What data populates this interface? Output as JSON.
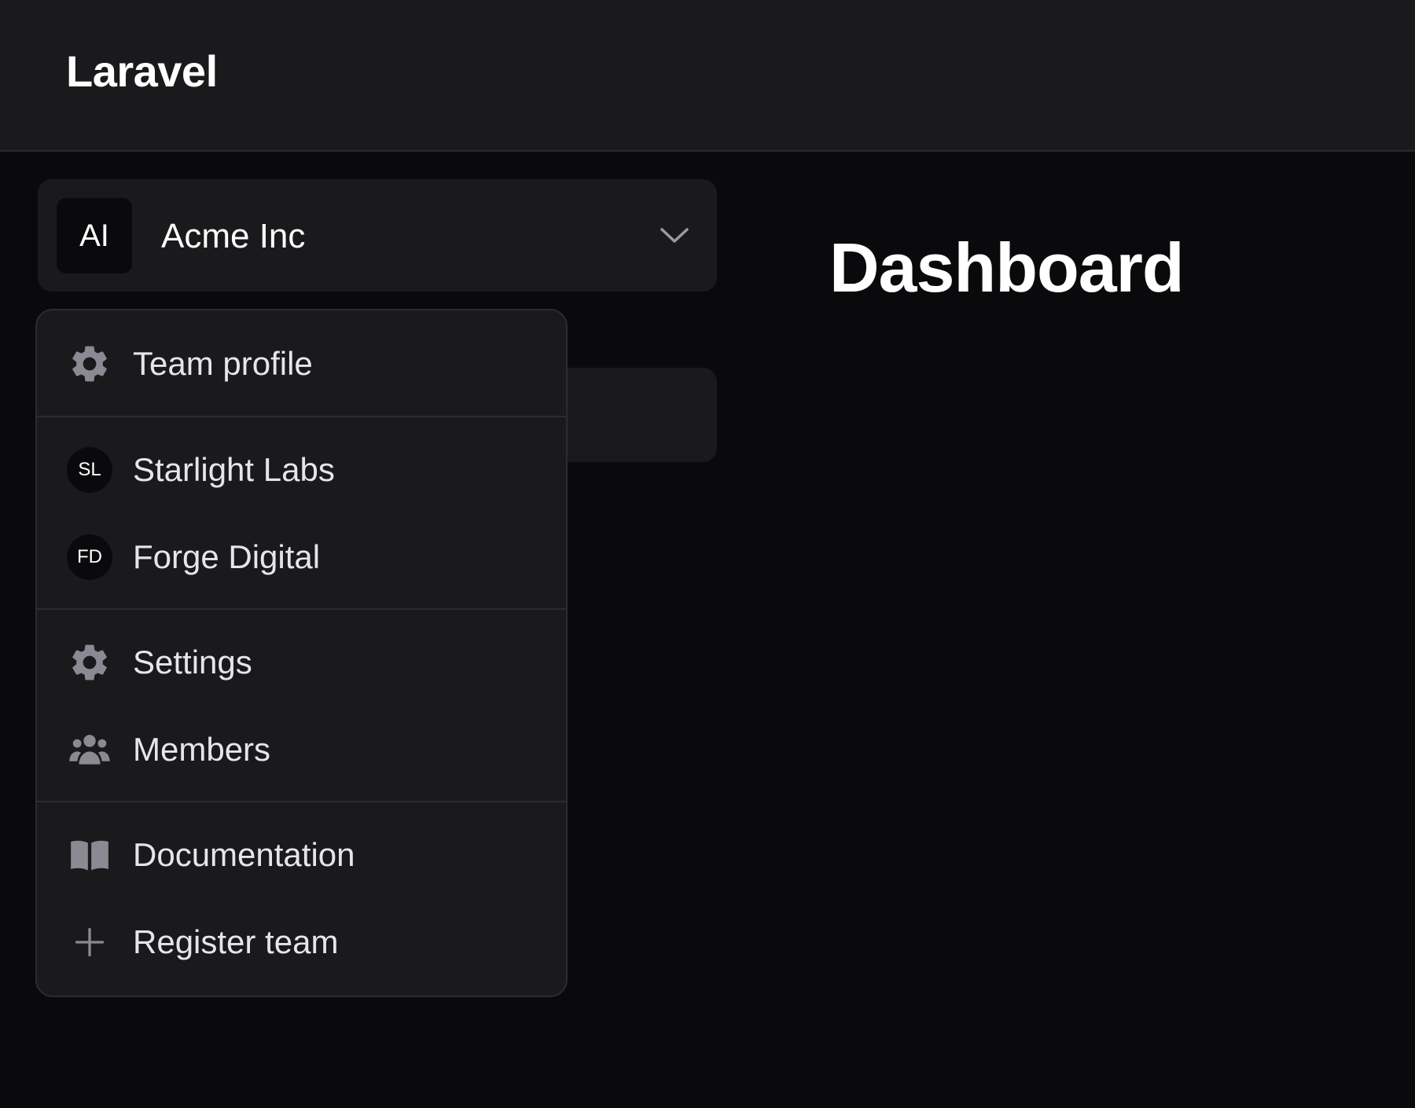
{
  "header": {
    "brand": "Laravel"
  },
  "team_switcher": {
    "avatar_initials": "AI",
    "team_name": "Acme Inc",
    "chevron_icon": "chevron-down-icon"
  },
  "main": {
    "title": "Dashboard"
  },
  "dropdown": {
    "team_profile": {
      "label": "Team profile",
      "icon": "gear-icon"
    },
    "teams": [
      {
        "initials": "SL",
        "label": "Starlight Labs"
      },
      {
        "initials": "FD",
        "label": "Forge Digital"
      }
    ],
    "settings": {
      "label": "Settings",
      "icon": "gear-icon"
    },
    "members": {
      "label": "Members",
      "icon": "users-icon"
    },
    "documentation": {
      "label": "Documentation",
      "icon": "book-icon"
    },
    "register_team": {
      "label": "Register team",
      "icon": "plus-icon"
    }
  },
  "colors": {
    "background": "#0a0a0c",
    "panel": "#1a1a1d",
    "icon": "#8a8a93",
    "text": "#ececef"
  }
}
